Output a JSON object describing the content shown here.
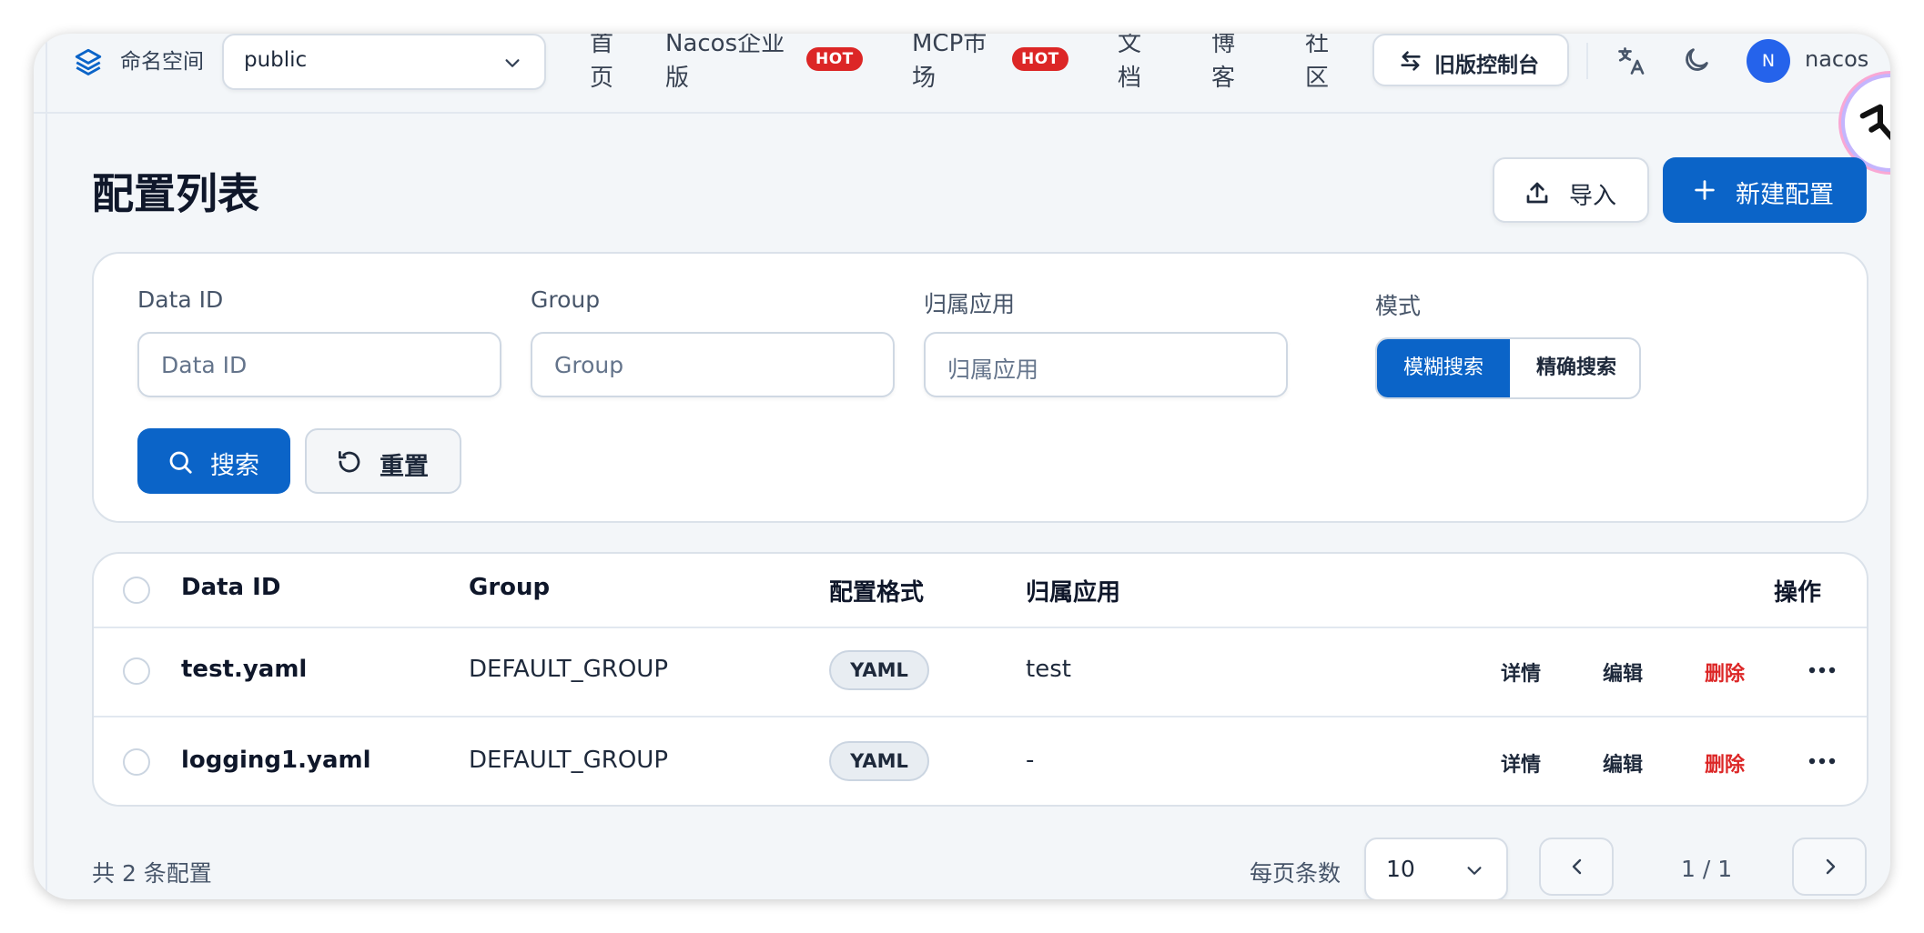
{
  "header": {
    "namespace_label": "命名空间",
    "namespace_value": "public",
    "nav": {
      "home": [
        "首",
        "页"
      ],
      "enterprise": {
        "label_line1": "Nacos企业",
        "label_line2": "版",
        "badge": "HOT"
      },
      "mcp": {
        "label_line1": "MCP市",
        "label_line2": "场",
        "badge": "HOT"
      },
      "docs": [
        "文",
        "档"
      ],
      "blog": [
        "博",
        "客"
      ],
      "community": [
        "社",
        "区"
      ]
    },
    "old_console": "旧版控制台",
    "avatar_initial": "N",
    "username": "nacos"
  },
  "page": {
    "title": "配置列表",
    "import_label": "导入",
    "new_label": "新建配置"
  },
  "filters": {
    "data_id": {
      "label": "Data ID",
      "placeholder": "Data ID"
    },
    "group": {
      "label": "Group",
      "placeholder": "Group"
    },
    "app": {
      "label": "归属应用",
      "placeholder": "归属应用"
    },
    "mode": {
      "label": "模式",
      "fuzzy": "模糊搜索",
      "exact": "精确搜索",
      "selected": "模糊搜索"
    },
    "search_label": "搜索",
    "reset_label": "重置"
  },
  "table": {
    "headers": {
      "data_id": "Data ID",
      "group": "Group",
      "format": "配置格式",
      "app": "归属应用",
      "actions": "操作"
    },
    "rows": [
      {
        "data_id": "test.yaml",
        "group": "DEFAULT_GROUP",
        "format": "YAML",
        "app": "test"
      },
      {
        "data_id": "logging1.yaml",
        "group": "DEFAULT_GROUP",
        "format": "YAML",
        "app": "-"
      }
    ],
    "actions": {
      "detail": "详情",
      "edit": "编辑",
      "delete": "删除"
    }
  },
  "footer": {
    "total": "共 2 条配置",
    "per_page_label": "每页条数",
    "per_page_value": "10",
    "page_info": "1 / 1"
  },
  "colors": {
    "primary": "#0b64c8",
    "danger": "#dc2626",
    "background": "#f3f6f9"
  }
}
